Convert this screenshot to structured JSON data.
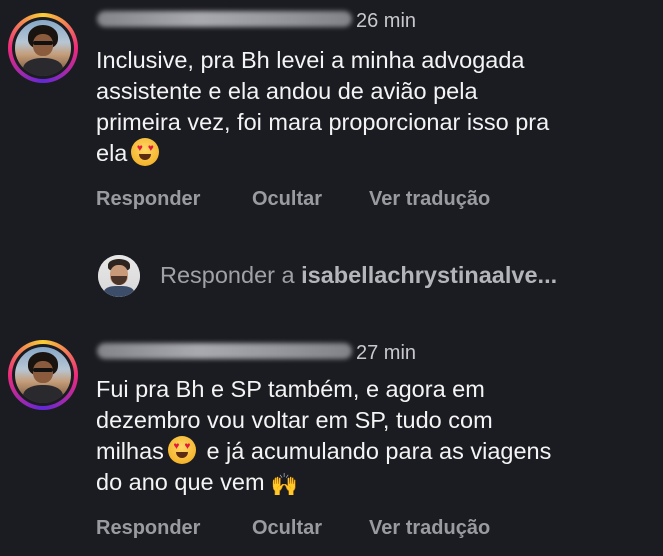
{
  "comments": [
    {
      "time": "26 min",
      "lines": [
        "Inclusive, pra Bh levei a minha advogada",
        "assistente e ela andou de avião pela",
        "primeira vez, foi mara proporcionar isso pra",
        "ela"
      ],
      "emoji": "heart-eyes-emoji",
      "actions": {
        "reply": "Responder",
        "hide": "Ocultar",
        "translate": "Ver tradução"
      }
    },
    {
      "time": "27 min",
      "lines": [
        "Fui pra Bh e SP também, e agora em",
        "dezembro vou voltar em SP, tudo com",
        "milhas",
        "e já acumulando para as viagens",
        "do ano que vem"
      ],
      "emojis": [
        "heart-eyes-emoji",
        "raising-hands-emoji"
      ],
      "actions": {
        "reply": "Responder",
        "hide": "Ocultar",
        "translate": "Ver tradução"
      }
    }
  ],
  "reply_input": {
    "prefix": "Responder a ",
    "username": "isabellachrystinaalve..."
  },
  "colors": {
    "background": "#1b1c22",
    "text": "#f4f4f4",
    "muted": "#9a9ba1"
  }
}
